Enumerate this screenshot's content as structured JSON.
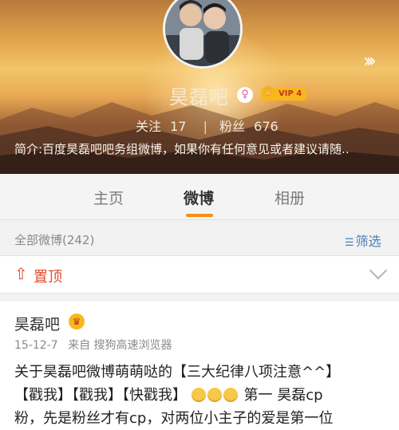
{
  "profile": {
    "name": "昊磊吧",
    "gender_icon": "female-icon",
    "vip_label": "VIP 4",
    "following_label": "关注",
    "following_count": "17",
    "followers_label": "粉丝",
    "followers_count": "676",
    "intro": "简介:百度昊磊吧吧务组微博，如果你有任何意见或者建议请随.."
  },
  "tabs": [
    {
      "label": "主页",
      "active": false
    },
    {
      "label": "微博",
      "active": true
    },
    {
      "label": "相册",
      "active": false
    }
  ],
  "filter_bar": {
    "count_text": "全部微博(242)",
    "filter_label": "筛选"
  },
  "pinned": {
    "label": "置顶"
  },
  "post": {
    "author": "昊磊吧",
    "date": "15-12-7",
    "source": "来自 搜狗高速浏览器",
    "line1": "关于昊磊吧微博萌萌哒的【三大纪律八项注意^^】",
    "line2_a": "【戳我】【戳我】【快戳我】",
    "line2_b": "第一 昊磊cp",
    "line3": "粉，先是粉丝才有cp，对两位小主子的爱是第一位"
  },
  "colors": {
    "accent_orange": "#f39118",
    "pinned_red": "#e24a2a",
    "filter_blue": "#4a7eb8",
    "vip_gold": "#f8b81c"
  }
}
